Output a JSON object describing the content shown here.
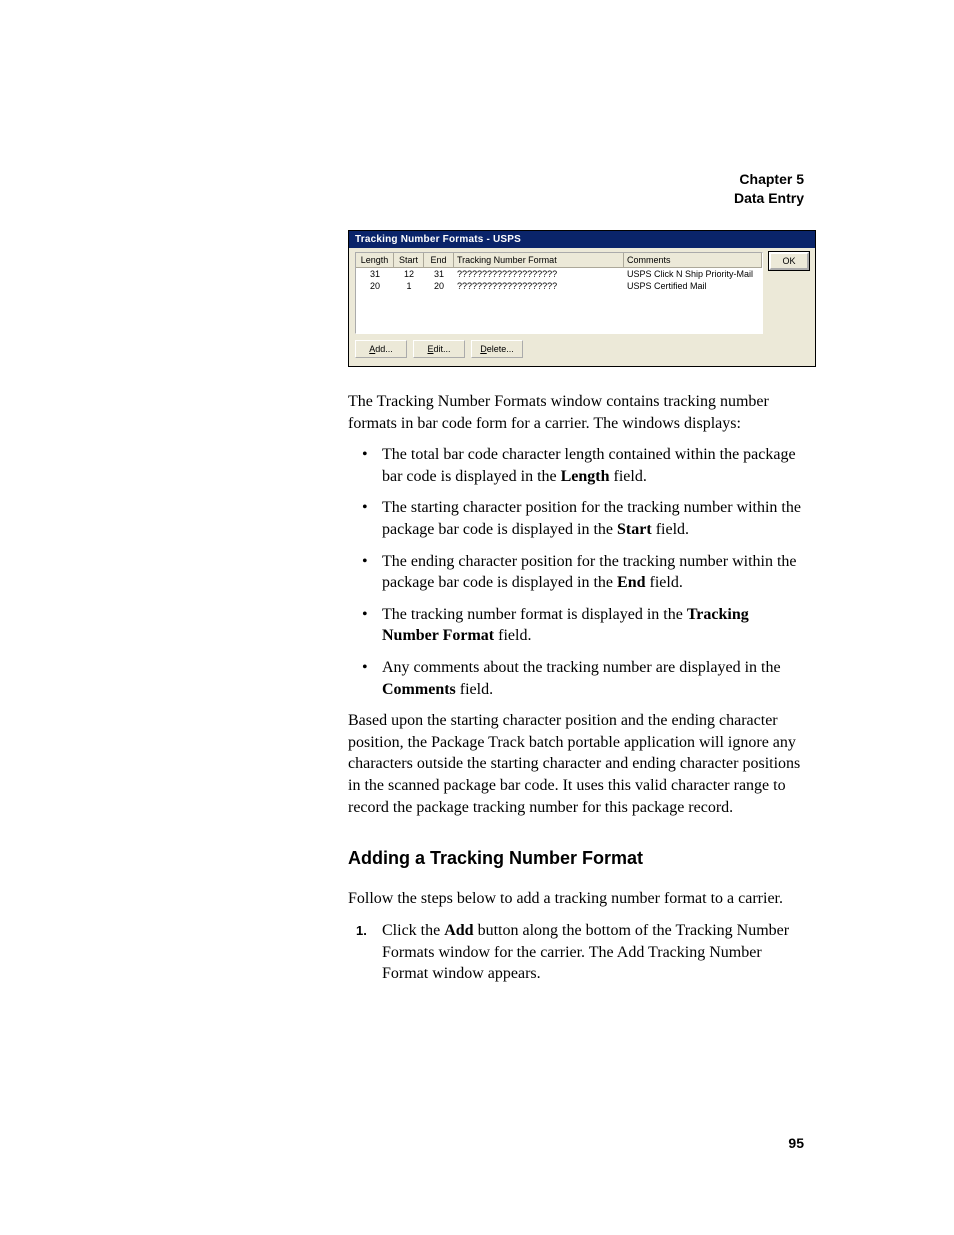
{
  "header": {
    "chapter": "Chapter 5",
    "title": "Data Entry"
  },
  "window": {
    "title": "Tracking Number Formats - USPS",
    "columns": {
      "length": "Length",
      "start": "Start",
      "end": "End",
      "format": "Tracking Number Format",
      "comments": "Comments"
    },
    "rows": [
      {
        "length": "31",
        "start": "12",
        "end": "31",
        "format": "????????????????????",
        "comments": "USPS Click N Ship Priority-Mail"
      },
      {
        "length": "20",
        "start": "1",
        "end": "20",
        "format": "????????????????????",
        "comments": "USPS Certified Mail"
      }
    ],
    "buttons": {
      "ok": "OK",
      "add": {
        "ul": "A",
        "rest": "dd..."
      },
      "edit": {
        "ul": "E",
        "rest": "dit..."
      },
      "delete": {
        "ul": "D",
        "rest": "elete..."
      }
    }
  },
  "body": {
    "intro": "The Tracking Number Formats window contains tracking number formats in bar code form for a carrier. The windows displays:",
    "bullets": [
      {
        "pre": " The total bar code character length contained within the package bar code is displayed in the ",
        "bold": "Length",
        "post": " field."
      },
      {
        "pre": "The starting character position for the tracking number within the package bar code is displayed in the ",
        "bold": "Start",
        "post": " field."
      },
      {
        "pre": "The ending character position for the tracking number within the package bar code is displayed in the ",
        "bold": "End",
        "post": " field."
      },
      {
        "pre": "The tracking number format is displayed in the ",
        "bold": "Tracking Number Format",
        "post": " field."
      },
      {
        "pre": "Any comments about the tracking number are displayed in the ",
        "bold": "Comments",
        "post": " field."
      }
    ],
    "para2": "Based upon the starting character position and the ending character position, the Package Track batch portable application will ignore any characters outside the starting character and ending character positions in the scanned package bar code. It uses this valid character range to record the package tracking number for this package record.",
    "section_title": "Adding a Tracking Number Format",
    "para3": "Follow the steps below to add a tracking number format to a carrier.",
    "step1": {
      "pre": "Click the ",
      "bold": "Add",
      "post": " button along the bottom of the Tracking Number Formats window for the carrier. The Add Tracking Number Format window appears."
    }
  },
  "pagenum": "95"
}
